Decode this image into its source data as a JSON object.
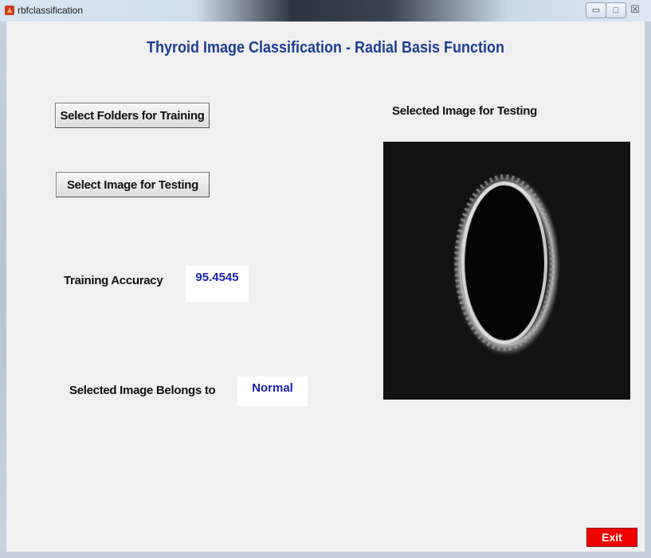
{
  "window": {
    "title": "rbfclassification",
    "controls": {
      "minimize": "▭",
      "maximize": "□",
      "close": "☒"
    }
  },
  "main": {
    "title": "Thyroid Image Classification - Radial Basis Function",
    "buttons": {
      "select_folders": "Select Folders for Training",
      "select_image": "Select Image for Testing",
      "exit": "Exit"
    },
    "labels": {
      "selected_image_for_testing": "Selected Image for Testing",
      "training_accuracy": "Training Accuracy",
      "selected_image_belongs_to": "Selected Image Belongs to"
    },
    "values": {
      "training_accuracy": "95.4545",
      "class": "Normal"
    },
    "image_panel": {
      "icon": "ultrasound-thyroid-image"
    }
  },
  "colors": {
    "title": "#1c3f95",
    "value_text": "#1a22b8",
    "exit_button": "#f20000",
    "background": "#f0f0f0"
  }
}
